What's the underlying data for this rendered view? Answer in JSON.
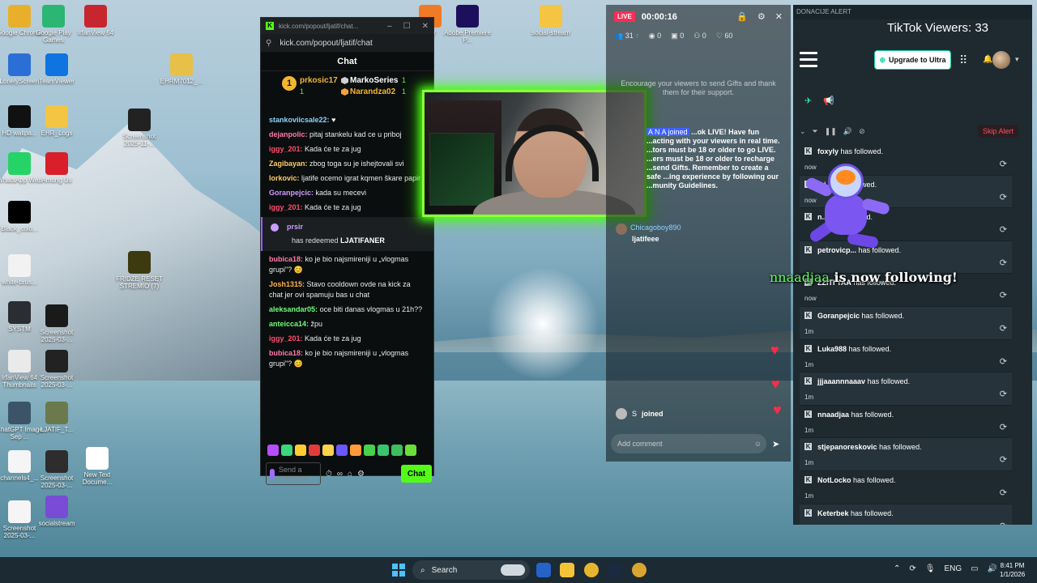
{
  "desktop": {
    "icons": [
      {
        "label": "Google Chrome",
        "color": "#e8b02a"
      },
      {
        "label": "Google Play Games",
        "color": "#2bb673"
      },
      {
        "label": "IrfanView 64",
        "color": "#c8262f"
      },
      {
        "label": "LonelyScreen",
        "color": "#2b6fd6"
      },
      {
        "label": "TeamViewer",
        "color": "#0e74e0"
      },
      {
        "label": "EHRM7012_...",
        "color": "#e7c04a"
      },
      {
        "label": "HD wallpa...",
        "color": "#111111"
      },
      {
        "label": "EHR_Logs",
        "color": "#f4c542"
      },
      {
        "label": "Screenshot 2025-11-...",
        "color": "#222222"
      },
      {
        "label": "WhatsApp Web",
        "color": "#25d366"
      },
      {
        "label": "Among Us",
        "color": "#d81f2a"
      },
      {
        "label": "Black_colo...",
        "color": "#000000"
      },
      {
        "label": "white-brus...",
        "color": "#f2f2f2"
      },
      {
        "label": "FRIDZE RESET STREMIO (7)",
        "color": "#3d3a10"
      },
      {
        "label": "SYSTM",
        "color": "#2a2d31"
      },
      {
        "label": "Screenshot 2025-03-...",
        "color": "#1a1a1a"
      },
      {
        "label": "IrfanView 64 Thumbnails",
        "color": "#eaeaea"
      },
      {
        "label": "Screenshot 2025-03-...",
        "color": "#222222"
      },
      {
        "label": "ChatGPT Image Sep ...",
        "color": "#3b5468"
      },
      {
        "label": "LJATIF_T...",
        "color": "#6a7a4d"
      },
      {
        "label": "channels4_...",
        "color": "#f5f5f5"
      },
      {
        "label": "Screenshot 2025-03-...",
        "color": "#2d2d2d"
      },
      {
        "label": "New Text Docume...",
        "color": "#ffffff"
      },
      {
        "label": "Screenshot 2025-03-...",
        "color": "#f5f5f5"
      },
      {
        "label": "socialstream",
        "color": "#7a4bd6"
      },
      {
        "label": "Adobe Premiere P...",
        "color": "#1e0f5c"
      },
      {
        "label": "social-stream",
        "color": "#f4c542"
      },
      {
        "label": "...er",
        "color": "#f07b26"
      }
    ]
  },
  "kick": {
    "window_title": "kick.com/popout/ljatif/chat...",
    "url": "kick.com/popout/ljatif/chat",
    "chat_title": "Chat",
    "top_gifters": {
      "first": {
        "rank": "1",
        "name": "prkosic17",
        "count": "1"
      },
      "second": {
        "name": "MarkoSeries",
        "count": "1"
      },
      "third": {
        "name": "Narandza02",
        "count": "1"
      }
    },
    "messages": [
      {
        "user": "stankoviicsale22:",
        "color": "#8fd3ff",
        "text": "♥"
      },
      {
        "user": "dejanpolic:",
        "color": "#ff7aa8",
        "text": "pitaj stankelu kad ce u priboj"
      },
      {
        "user": "iggy_201:",
        "color": "#ff4d6d",
        "text": "Kada će te za jug"
      },
      {
        "user": "Zagibayan:",
        "color": "#ffcc66",
        "text": "zbog toga su je ishejtovali svi"
      },
      {
        "user": "lorkovic:",
        "color": "#ffcc66",
        "text": "ljatife ocemo igrat kqmen škare papir"
      },
      {
        "user": "Goranpejcic:",
        "color": "#d29bff",
        "text": "kada su mecevi"
      },
      {
        "user": "iggy_201:",
        "color": "#ff4d6d",
        "text": "Kada će te za jug"
      }
    ],
    "redeem": {
      "user": "prsir",
      "text": "has redeemed",
      "reward": "LJATIFANER"
    },
    "messages2": [
      {
        "user": "bubica18:",
        "color": "#ff7aa8",
        "text": "ko je bio najsmireniji u „vlogmas grupi\"? 😊"
      },
      {
        "user": "Josh1315:",
        "color": "#ffb347",
        "text": "Stavo cooldown ovde na kick za chat jer ovi spamuju bas u chat"
      },
      {
        "user": "aleksandar05:",
        "color": "#6fff7a",
        "text": "oce biti danas vlogmas u 21h??"
      },
      {
        "user": "anteicca14:",
        "color": "#6fff7a",
        "text": "žpu"
      },
      {
        "user": "iggy_201:",
        "color": "#ff4d6d",
        "text": "Kada će te za jug"
      },
      {
        "user": "bubica18:",
        "color": "#ff7aa8",
        "text": "ko je bio najsmireniji u „vlogmas grupi\"? 😊"
      }
    ],
    "input_placeholder": "Send a message",
    "chat_button": "Chat",
    "emote_colors": [
      "#b64dff",
      "#3bd77c",
      "#ffcc33",
      "#e23b3b",
      "#ffd24d",
      "#6b57ff",
      "#ff9b3b",
      "#48d14a",
      "#39c46e",
      "#3fbf5c",
      "#6adf3a"
    ]
  },
  "tiktok": {
    "badge": "LIVE",
    "timer": "00:00:16",
    "stats": {
      "viewers": "31",
      "views": "0",
      "gifts": "0",
      "shares": "0",
      "likes": "60"
    },
    "encourage": "Encourage your viewers to send Gifts and thank them for their support.",
    "joined_highlight": "A N A joined",
    "guideline_text": "...ok LIVE! Have fun ...acting with your viewers in real time. ...tors must be 18 or older to go LIVE. ...ers must be 18 or older to recharge ...send Gifts. Remember to create a safe ...ing experience by following our ...munity Guidelines.",
    "comment": {
      "user": "Chicagoboy890",
      "text": "ljatifeee"
    },
    "joined_row": {
      "user": "S",
      "text": "joined"
    },
    "add_comment": "Add comment"
  },
  "donacije": {
    "title": "DONACIJE ALERT",
    "viewers": "TikTok Viewers: 33",
    "upgrade": "Upgrade to Ultra",
    "skip": "Skip Alert",
    "follows": [
      {
        "name": "foxyly",
        "text": "has followed.",
        "when": "now"
      },
      {
        "name": "mi...",
        "text": "has followed.",
        "when": "now"
      },
      {
        "name": "n...",
        "text": "has followed.",
        "when": ""
      },
      {
        "name": "petrovicp...",
        "text": "has followed.",
        "when": ""
      },
      {
        "name": "ZZITI TAA",
        "text": "has followed.",
        "when": "now"
      },
      {
        "name": "Goranpejcic",
        "text": "has followed.",
        "when": "1m"
      },
      {
        "name": "Luka988",
        "text": "has followed.",
        "when": "1m"
      },
      {
        "name": "jjjaaannnaaav",
        "text": "has followed.",
        "when": "1m"
      },
      {
        "name": "nnaadjaa",
        "text": "has followed.",
        "when": "1m"
      },
      {
        "name": "stjepanoreskovic",
        "text": "has followed.",
        "when": "1m"
      },
      {
        "name": "NotLocko",
        "text": "has followed.",
        "when": "1m"
      },
      {
        "name": "Keterbek",
        "text": "has followed.",
        "when": ""
      }
    ]
  },
  "overlay": {
    "follower_name": "nnaadjaa",
    "follower_text": " is now following!"
  },
  "taskbar": {
    "search": "Search",
    "lang": "ENG",
    "time": "8:41 PM",
    "date": "1/1/2026"
  }
}
